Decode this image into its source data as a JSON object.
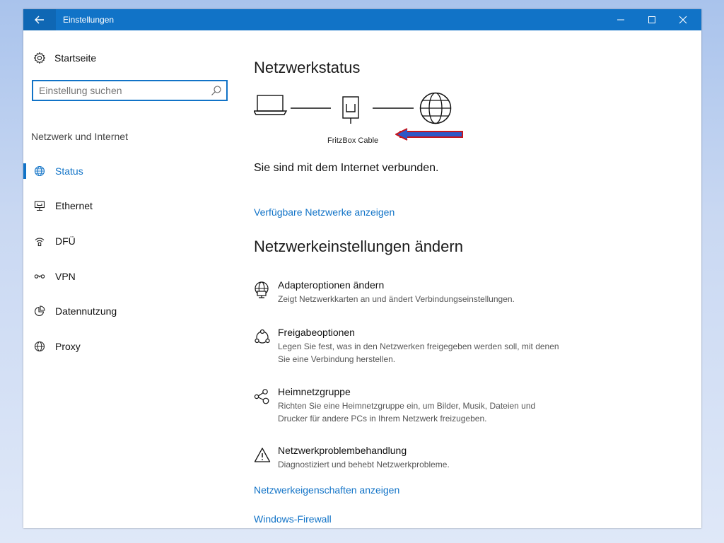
{
  "window": {
    "title": "Einstellungen",
    "accent_color": "#1173c7",
    "back_icon": "arrow-left-icon",
    "controls": [
      "minimize-icon",
      "maximize-icon",
      "close-icon"
    ]
  },
  "sidebar": {
    "home_label": "Startseite",
    "home_icon": "gear-icon",
    "search_placeholder": "Einstellung suchen",
    "search_icon": "search-icon",
    "section_label": "Netzwerk und Internet",
    "items": [
      {
        "label": "Status",
        "icon": "globe-status-icon",
        "active": true
      },
      {
        "label": "Ethernet",
        "icon": "ethernet-icon",
        "active": false
      },
      {
        "label": "DFÜ",
        "icon": "dialup-icon",
        "active": false
      },
      {
        "label": "VPN",
        "icon": "vpn-icon",
        "active": false
      },
      {
        "label": "Datennutzung",
        "icon": "pie-chart-icon",
        "active": false
      },
      {
        "label": "Proxy",
        "icon": "globe-icon",
        "active": false
      }
    ]
  },
  "main": {
    "status_heading": "Netzwerkstatus",
    "device_label": "FritzBox Cable",
    "connection_text": "Sie sind mit dem Internet verbunden.",
    "available_networks_link": "Verfügbare Netzwerke anzeigen",
    "change_heading": "Netzwerkeinstellungen ändern",
    "settings": [
      {
        "title": "Adapteroptionen ändern",
        "desc": "Zeigt Netzwerkkarten an und ändert Verbindungseinstellungen.",
        "icon": "adapter-globe-icon"
      },
      {
        "title": "Freigabeoptionen",
        "desc": "Legen Sie fest, was in den Netzwerken freigegeben werden soll, mit denen Sie eine Verbindung herstellen.",
        "icon": "sharing-icon"
      },
      {
        "title": "Heimnetzgruppe",
        "desc": "Richten Sie eine Heimnetzgruppe ein, um Bilder, Musik, Dateien und Drucker für andere PCs in Ihrem Netzwerk freizugeben.",
        "icon": "homegroup-icon"
      },
      {
        "title": "Netzwerkproblembehandlung",
        "desc": "Diagnostiziert und behebt Netzwerkprobleme.",
        "icon": "warning-icon"
      }
    ],
    "properties_link": "Netzwerkeigenschaften anzeigen",
    "firewall_link": "Windows-Firewall"
  }
}
